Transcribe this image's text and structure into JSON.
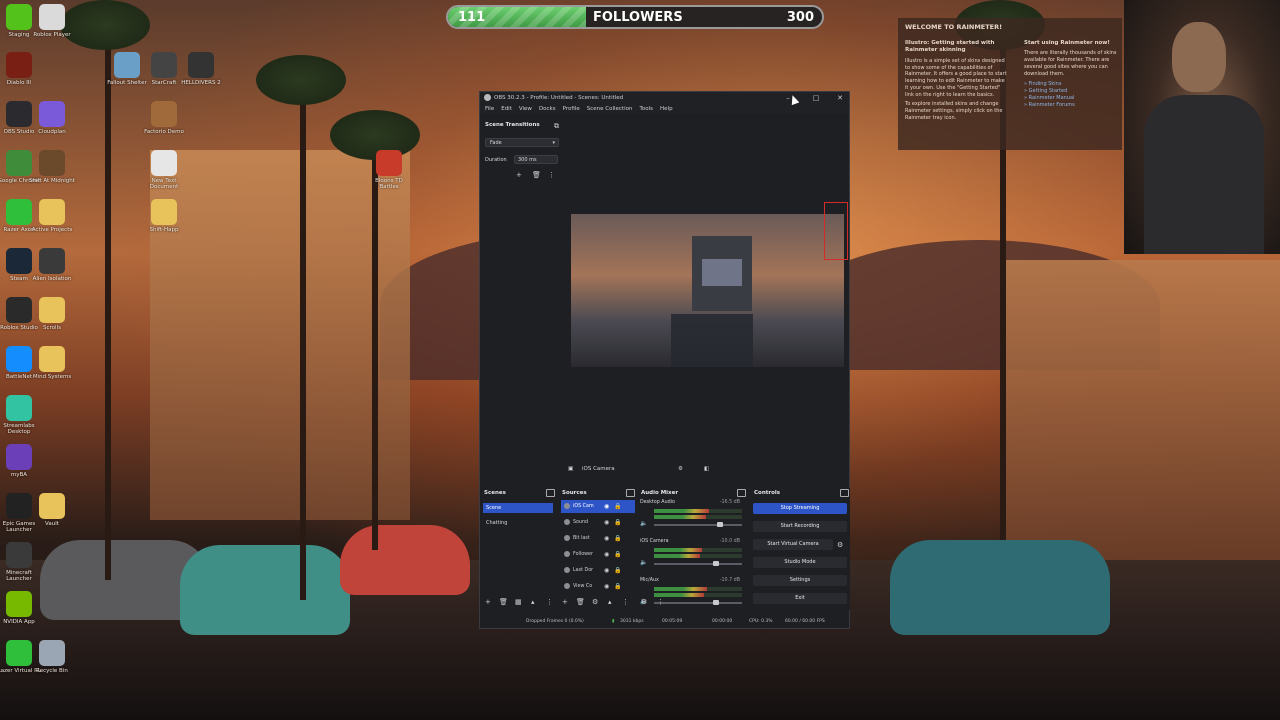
{
  "followers_bar": {
    "current": "111",
    "label": "FOLLOWERS",
    "goal": "300",
    "progress_fraction": 0.37,
    "colors": {
      "fill": "#4fb354",
      "track": "#262322"
    }
  },
  "desktop_icons": [
    {
      "name": "Staging",
      "icon": "k-icon",
      "color": "#53c21b"
    },
    {
      "name": "Diablo III",
      "icon": "diablo-icon",
      "color": "#7a1f14"
    },
    {
      "name": "OBS Studio",
      "icon": "obs-icon",
      "color": "#2b2b2f"
    },
    {
      "name": "Google Chrome",
      "icon": "chrome-icon",
      "color": "#3f8d3b"
    },
    {
      "name": "Razer Axon",
      "icon": "razer-icon",
      "color": "#2fbf3a"
    },
    {
      "name": "Steam",
      "icon": "steam-icon",
      "color": "#1b2838"
    },
    {
      "name": "Roblox Studio",
      "icon": "roblox-studio-icon",
      "color": "#2a2a2a"
    },
    {
      "name": "BattleNet",
      "icon": "battlenet-icon",
      "color": "#148eff"
    },
    {
      "name": "Streamlabs Desktop",
      "icon": "streamlabs-icon",
      "color": "#31c3a2"
    },
    {
      "name": "myBA",
      "icon": "myba-icon",
      "color": "#6b3fb8"
    },
    {
      "name": "Epic Games Launcher",
      "icon": "epic-icon",
      "color": "#222"
    },
    {
      "name": "Minecraft Launcher",
      "icon": "minecraft-icon",
      "color": "#3a3a3a"
    },
    {
      "name": "NVIDIA App",
      "icon": "nvidia-icon",
      "color": "#76b900"
    },
    {
      "name": "Razer Virtual RL",
      "icon": "razer-virtual-icon",
      "color": "#2fbf3a"
    },
    {
      "name": "Roblox Player",
      "icon": "roblox-icon",
      "color": "#dadada"
    },
    {
      "name": "Cloudplan",
      "icon": "cloud-icon",
      "color": "#7a5ad8"
    },
    {
      "name": "Shift At Midnight",
      "icon": "game-icon",
      "color": "#6a4a2a"
    },
    {
      "name": "Active Projects",
      "icon": "folder-icon",
      "color": "#e8c25a"
    },
    {
      "name": "Alien Isolation",
      "icon": "alien-icon",
      "color": "#3a3a3a"
    },
    {
      "name": "Scrolls",
      "icon": "folder-icon",
      "color": "#e8c25a"
    },
    {
      "name": "Mind Systems",
      "icon": "folder-icon",
      "color": "#e8c25a"
    },
    {
      "name": "Vault",
      "icon": "folder-icon",
      "color": "#e8c25a"
    },
    {
      "name": "Recycle Bin",
      "icon": "recycle-bin-icon",
      "color": "#9aa6b4"
    },
    {
      "name": "Fallout Shelter",
      "icon": "fallout-icon",
      "color": "#6aa0c8"
    },
    {
      "name": "StarCraft",
      "icon": "starcraft-icon",
      "color": "#444"
    },
    {
      "name": "HELLDIVERS 2",
      "icon": "helldivers-icon",
      "color": "#333"
    },
    {
      "name": "Factorio Demo",
      "icon": "factorio-icon",
      "color": "#a06a3a"
    },
    {
      "name": "New Text Document",
      "icon": "text-doc-icon",
      "color": "#e6e6e6"
    },
    {
      "name": "Shift-Happ",
      "icon": "folder-icon",
      "color": "#e8c25a"
    },
    {
      "name": "Bloons TD Battles",
      "icon": "bloons-icon",
      "color": "#c83a2a"
    }
  ],
  "rainmeter": {
    "heading": "WELCOME TO RAINMETER!",
    "left_title": "Illustro: Getting started with Rainmeter skinning",
    "left_body_1": "Illustro is a simple set of skins designed to show some of the capabilities of Rainmeter. It offers a good place to start learning how to edit Rainmeter to make it your own. Use the \"Getting Started\" link on the right to learn the basics.",
    "left_body_2": "To explore installed skins and change Rainmeter settings, simply click on the Rainmeter tray icon.",
    "right_title": "Start using Rainmeter now!",
    "right_body": "There are literally thousands of skins available for Rainmeter. There are several good sites where you can download them.",
    "links": [
      "» Finding Skins",
      "» Getting Started",
      "» Rainmeter Manual",
      "» Rainmeter Forums"
    ]
  },
  "obs": {
    "title": "OBS 30.2.3 - Profile: Untitled - Scenes: Untitled",
    "menu": [
      "File",
      "Edit",
      "View",
      "Docks",
      "Profile",
      "Scene Collection",
      "Tools",
      "Help"
    ],
    "scene_transitions": {
      "header": "Scene Transitions",
      "transition": "Fade",
      "duration_label": "Duration",
      "duration_value": "300 ms"
    },
    "source_bar_label": "iOS Camera",
    "scenes": {
      "header": "Scenes",
      "items": [
        "Scene",
        "Chatting"
      ],
      "active_index": 0
    },
    "sources": {
      "header": "Sources",
      "items": [
        "iOS Cam",
        "Sound",
        "Bit last",
        "Follower",
        "Last Dor",
        "View Co"
      ],
      "active_index": 0
    },
    "audio_mixer": {
      "header": "Audio Mixer",
      "channels": [
        {
          "name": "Desktop Audio",
          "db": "-16.5 dB",
          "level": 0.62,
          "volume": 0.75
        },
        {
          "name": "iOS Camera",
          "db": "-10.0 dB",
          "level": 0.55,
          "volume": 0.7
        },
        {
          "name": "Mic/Aux",
          "db": "-10.7 dB",
          "level": 0.6,
          "volume": 0.7
        }
      ]
    },
    "controls": {
      "header": "Controls",
      "buttons": [
        "Stop Streaming",
        "Start Recording",
        "Start Virtual Camera",
        "Studio Mode",
        "Settings",
        "Exit"
      ]
    },
    "status": {
      "dropped": "Dropped Frames 0 (0.0%)",
      "bitrate": "3031 kbps",
      "stream_time": "00:05:09",
      "rec_time": "00:00:00",
      "cpu": "CPU: 0.3%",
      "fps": "60.00 / 60.00 FPS"
    },
    "colors": {
      "accent": "#2d55c8",
      "bg": "#1e1f22"
    }
  }
}
